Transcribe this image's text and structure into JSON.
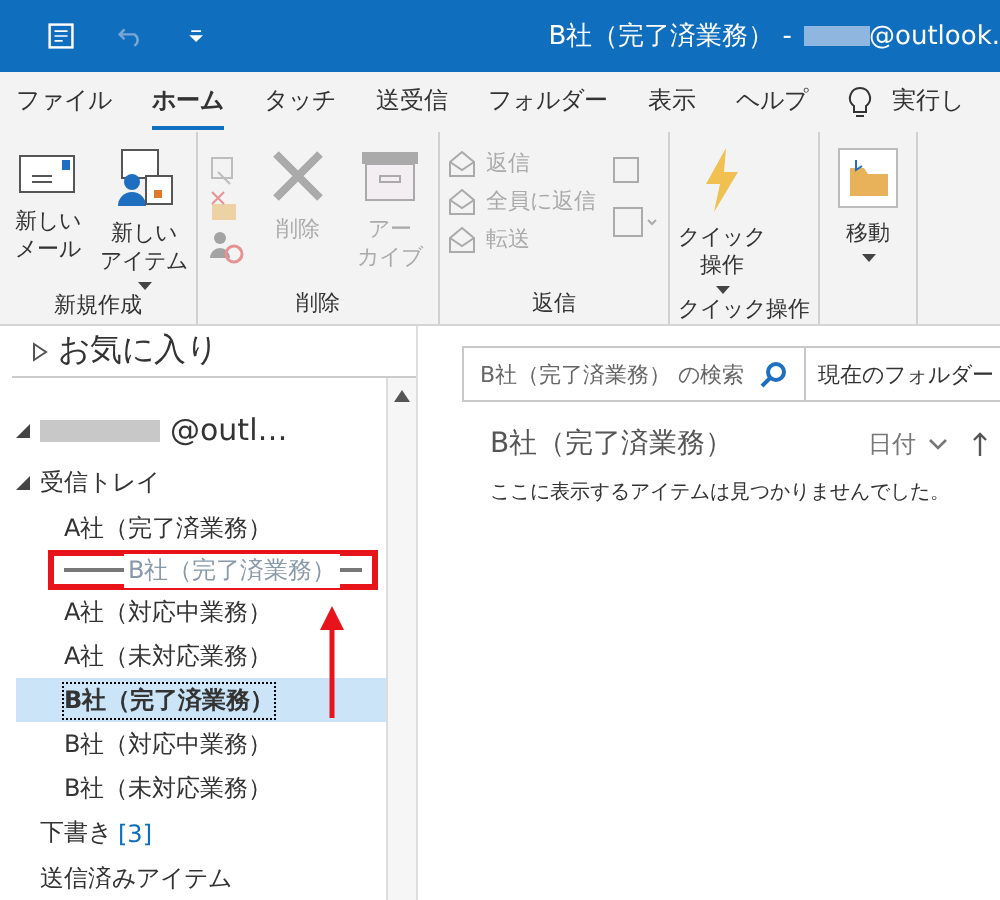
{
  "title_bar": {
    "title": "B社（完了済業務） -",
    "account_suffix": "@outlook."
  },
  "tabs": [
    {
      "label": "ファイル",
      "selected": false
    },
    {
      "label": "ホーム",
      "selected": true
    },
    {
      "label": "タッチ",
      "selected": false
    },
    {
      "label": "送受信",
      "selected": false
    },
    {
      "label": "フォルダー",
      "selected": false
    },
    {
      "label": "表示",
      "selected": false
    },
    {
      "label": "ヘルプ",
      "selected": false
    }
  ],
  "tell_me": "実行し",
  "ribbon_groups": [
    {
      "label": "新規作成",
      "commands": [
        {
          "kind": "new-mail",
          "label": [
            "新しい",
            "メール"
          ],
          "disabled": false
        },
        {
          "kind": "new-item",
          "label": [
            "新しい",
            "アイテム"
          ],
          "disabled": false
        }
      ]
    },
    {
      "label": "削除",
      "commands": [
        {
          "kind": "small-icons",
          "disabled": true
        },
        {
          "kind": "delete",
          "label": [
            "削除"
          ],
          "disabled": true
        },
        {
          "kind": "archive",
          "label": [
            "アー",
            "カイブ"
          ],
          "disabled": true
        }
      ]
    },
    {
      "label": "返信",
      "commands": [
        {
          "kind": "reply-list",
          "items": [
            "返信",
            "全員に返信",
            "転送"
          ],
          "disabled": true
        },
        {
          "kind": "more",
          "disabled": true
        }
      ]
    },
    {
      "label": "クイック操作",
      "commands": [
        {
          "kind": "quick",
          "label": [
            "クイック",
            "操作"
          ],
          "disabled": false
        }
      ]
    },
    {
      "commands": [
        {
          "kind": "move",
          "label": [
            "移動"
          ],
          "disabled": false
        }
      ]
    }
  ],
  "favorites": {
    "label": "お気に入り",
    "expanded": false
  },
  "account": {
    "name": "@outl…",
    "expanded": true
  },
  "inbox": {
    "label": "受信トレイ",
    "expanded": true,
    "children": [
      {
        "label": "A社（完了済業務）",
        "selected": false
      },
      {
        "label": "A社（対応中業務）",
        "selected": false
      },
      {
        "label": "A社（未対応業務）",
        "selected": false
      },
      {
        "label": "B社（完了済業務）",
        "selected": true
      },
      {
        "label": "B社（対応中業務）",
        "selected": false
      },
      {
        "label": "B社（未対応業務）",
        "selected": false
      }
    ]
  },
  "folders": [
    {
      "label": "下書き",
      "count": "[3]"
    },
    {
      "label": "送信済みアイテム"
    }
  ],
  "drag_ghost": "B社（完了済業務）",
  "search": {
    "placeholder": "B社（完了済業務） の検索",
    "scope": "現在のフォルダー"
  },
  "folder_view": {
    "title": "B社（完了済業務）",
    "sort": "日付",
    "empty_message": "ここに表示するアイテムは見つかりませんでした。"
  }
}
